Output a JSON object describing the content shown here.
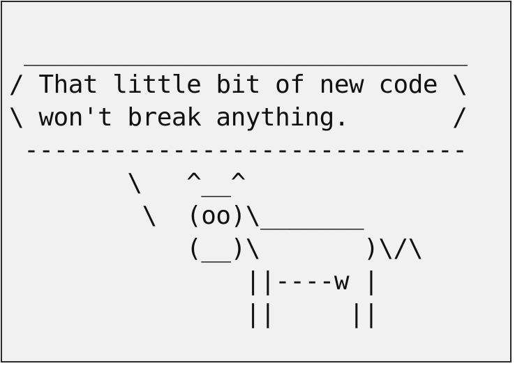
{
  "cowsay": {
    "lines": [
      " ______________________________",
      "/ That little bit of new code \\",
      "\\ won't break anything.       /",
      " ------------------------------",
      "        \\   ^__^",
      "         \\  (oo)\\_______",
      "            (__)\\       )\\/\\",
      "                ||----w |",
      "                ||     ||"
    ]
  }
}
